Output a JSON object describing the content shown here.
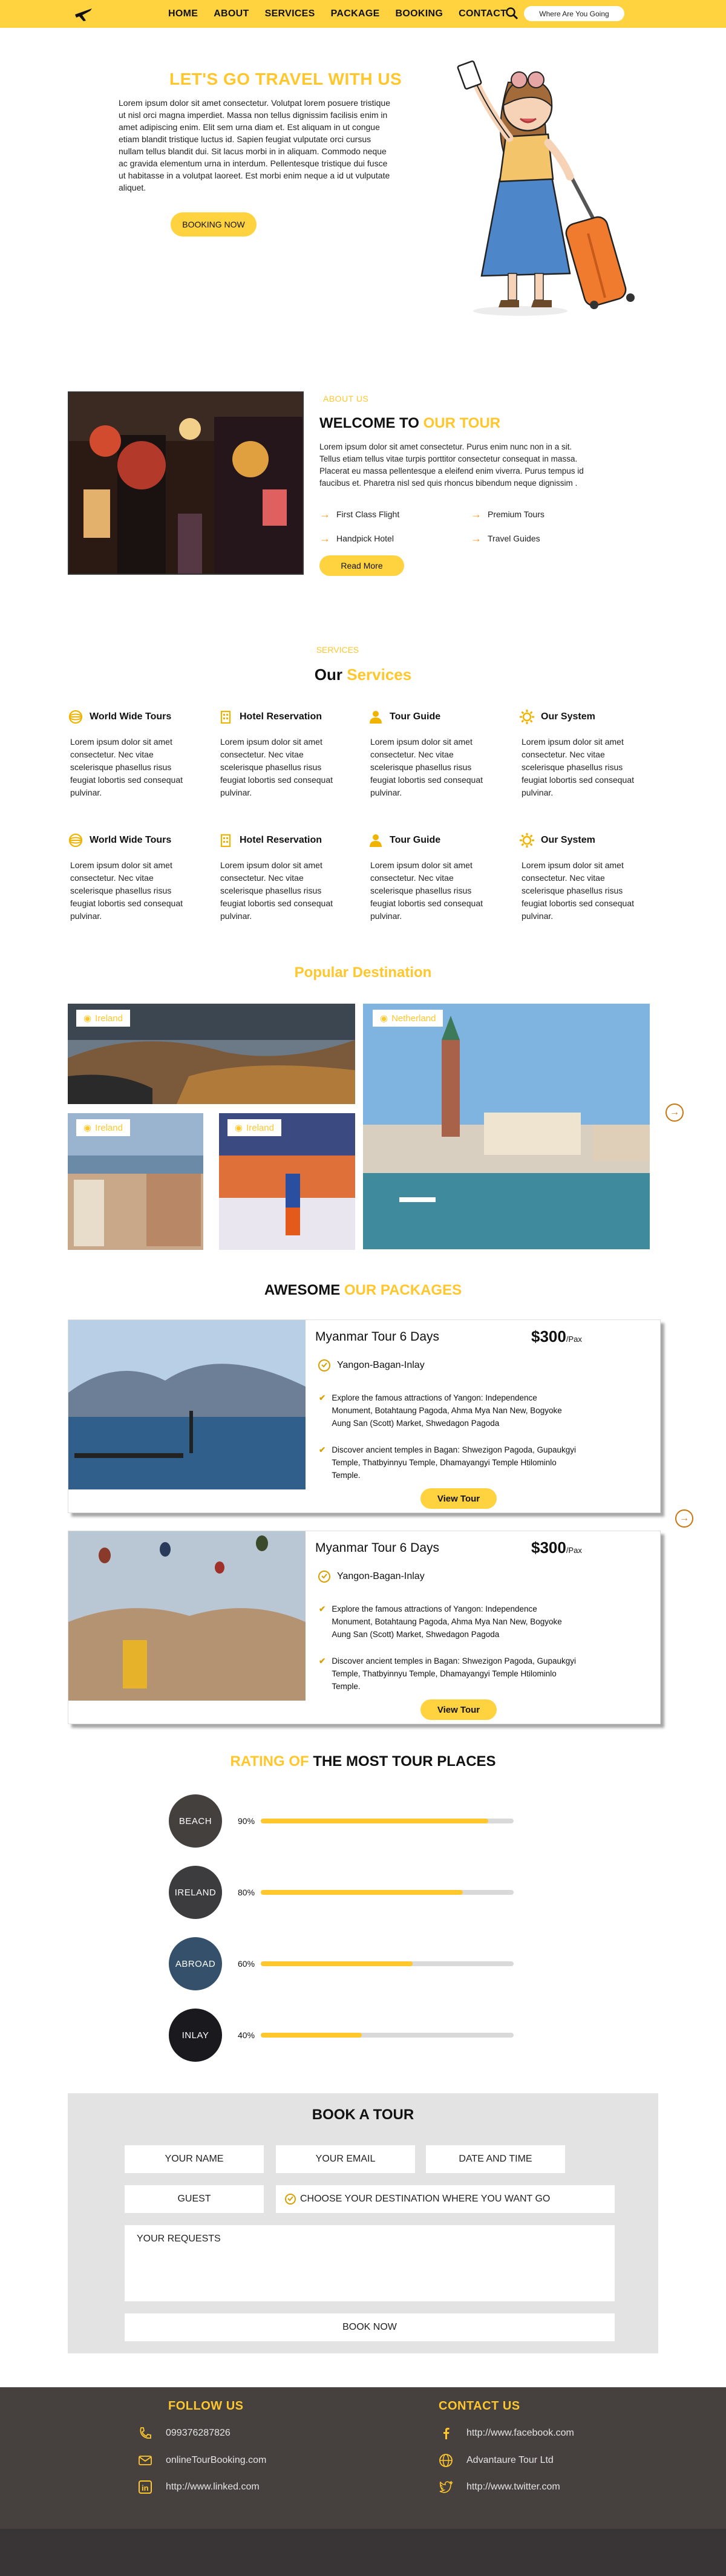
{
  "nav": {
    "items": [
      "HOME",
      "ABOUT",
      "SERVICES",
      "PACKAGE",
      "BOOKING",
      "CONTACT"
    ],
    "search_placeholder": "Where Are You Going"
  },
  "hero": {
    "title": "LET'S GO TRAVEL WITH US",
    "text": "Lorem ipsum dolor sit amet consectetur. Volutpat lorem posuere tristique ut nisl orci magna imperdiet. Massa non tellus dignissim facilisis enim in amet adipiscing enim. Elit sem urna diam et. Est aliquam in ut congue etiam blandit tristique luctus id. Sapien feugiat vulputate orci cursus nullam tellus blandit dui. Sit lacus morbi in in aliquam. Commodo neque ac gravida elementum urna in interdum. Pellentesque tristique dui fusce ut habitasse in a volutpat laoreet. Est morbi enim neque a id ut vulputate aliquet.",
    "button": "BOOKING NOW"
  },
  "about": {
    "eyebrow": "ABOUT US",
    "title_a": "WELCOME TO ",
    "title_b": "OUR TOUR",
    "text": "Lorem ipsum dolor sit amet consectetur. Purus enim nunc non in a sit. Tellus etiam tellus vitae turpis porttitor consectetur consequat in massa. Placerat eu massa pellentesque a eleifend enim viverra. Purus tempus id faucibus et. Pharetra nisl sed quis rhoncus bibendum neque dignissim .",
    "features": [
      "First Class Flight",
      "Premium Tours",
      "Handpick Hotel",
      "Travel Guides"
    ],
    "button": "Read More"
  },
  "services": {
    "eyebrow": "SERVICES",
    "title_a": "Our ",
    "title_b": "Services",
    "items": [
      {
        "title": "World Wide Tours",
        "icon": "globe-icon",
        "text": "Lorem ipsum dolor sit amet consectetur. Nec vitae scelerisque phasellus risus feugiat lobortis sed consequat pulvinar."
      },
      {
        "title": "Hotel Reservation",
        "icon": "building-icon",
        "text": "Lorem ipsum dolor sit amet consectetur. Nec vitae scelerisque phasellus risus feugiat lobortis sed consequat pulvinar."
      },
      {
        "title": "Tour Guide",
        "icon": "person-icon",
        "text": "Lorem ipsum dolor sit amet consectetur. Nec vitae scelerisque phasellus risus feugiat lobortis sed consequat pulvinar."
      },
      {
        "title": "Our System",
        "icon": "gear-icon",
        "text": "Lorem ipsum dolor sit amet consectetur. Nec vitae scelerisque phasellus risus feugiat lobortis sed consequat pulvinar."
      },
      {
        "title": "World Wide Tours",
        "icon": "globe-icon",
        "text": "Lorem ipsum dolor sit amet consectetur. Nec vitae scelerisque phasellus risus feugiat lobortis sed consequat pulvinar."
      },
      {
        "title": "Hotel Reservation",
        "icon": "building-icon",
        "text": "Lorem ipsum dolor sit amet consectetur. Nec vitae scelerisque phasellus risus feugiat lobortis sed consequat pulvinar."
      },
      {
        "title": "Tour Guide",
        "icon": "person-icon",
        "text": "Lorem ipsum dolor sit amet consectetur. Nec vitae scelerisque phasellus risus feugiat lobortis sed consequat pulvinar."
      },
      {
        "title": "Our System",
        "icon": "gear-icon",
        "text": "Lorem ipsum dolor sit amet consectetur. Nec vitae scelerisque phasellus risus feugiat lobortis sed consequat pulvinar."
      }
    ]
  },
  "destinations": {
    "title": "Popular Destination",
    "tags": [
      "Ireland",
      "Netherland",
      "Ireland",
      "Ireland"
    ]
  },
  "packages": {
    "title_a": "AWESOME ",
    "title_b": "OUR PACKAGES",
    "items": [
      {
        "title": "Myanmar Tour 6 Days",
        "price": "$300",
        "per": "/Pax",
        "route": "Yangon-Bagan-Inlay",
        "b1": "Explore the famous attractions of Yangon: Independence Monument, Botahtaung Pagoda, Ahma Mya Nan New, Bogyoke Aung San (Scott) Market, Shwedagon Pagoda",
        "b2": "Discover ancient temples in Bagan: Shwezigon Pagoda, Gupaukgyi Temple, Thatbyinnyu Temple, Dhamayangyi Temple Htilominlo Temple.",
        "button": "View Tour"
      },
      {
        "title": "Myanmar Tour 6 Days",
        "price": "$300",
        "per": "/Pax",
        "route": "Yangon-Bagan-Inlay",
        "b1": "Explore the famous attractions of Yangon: Independence Monument, Botahtaung Pagoda, Ahma Mya Nan New, Bogyoke Aung San (Scott) Market, Shwedagon Pagoda",
        "b2": "Discover ancient temples in Bagan: Shwezigon Pagoda, Gupaukgyi Temple, Thatbyinnyu Temple, Dhamayangyi Temple Htilominlo Temple.",
        "button": "View Tour"
      }
    ]
  },
  "rating": {
    "title_a": "RATING OF ",
    "title_b": "THE MOST TOUR PLACES",
    "items": [
      {
        "place": "BEACH",
        "label": "90%",
        "value": 0.9
      },
      {
        "place": "IRELAND",
        "label": "80%",
        "value": 0.8
      },
      {
        "place": "ABROAD",
        "label": "60%",
        "value": 0.6
      },
      {
        "place": "INLAY",
        "label": "40%",
        "value": 0.4
      }
    ]
  },
  "booking": {
    "title": "BOOK A TOUR",
    "name": "YOUR NAME",
    "email": "YOUR EMAIL",
    "date": "DATE AND TIME",
    "guest": "GUEST",
    "destination": "CHOOSE YOUR DESTINATION WHERE YOU WANT GO",
    "requests": "YOUR REQUESTS",
    "button": "BOOK NOW"
  },
  "footer": {
    "follow_title": "FOLLOW US",
    "contact_title": "CONTACT US",
    "phone": "099376287826",
    "email": "onlineTourBooking.com",
    "linkedin": "http://www.linked.com",
    "facebook": "http://www.facebook.com",
    "company": "Advantaure Tour Ltd",
    "twitter": "http://www.twitter.com"
  },
  "colors": {
    "accent": "#ffc72c",
    "nav": "#ffd23f",
    "footer": "#46403e",
    "arrow": "#c8760c"
  }
}
